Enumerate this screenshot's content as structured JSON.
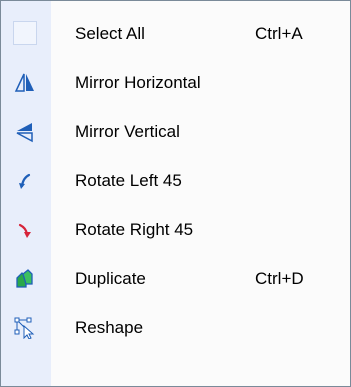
{
  "menu": {
    "items": [
      {
        "label": "Select All",
        "shortcut": "Ctrl+A",
        "icon": "blank-icon"
      },
      {
        "label": "Mirror Horizontal",
        "shortcut": "",
        "icon": "mirror-horizontal-icon"
      },
      {
        "label": "Mirror Vertical",
        "shortcut": "",
        "icon": "mirror-vertical-icon"
      },
      {
        "label": "Rotate Left 45",
        "shortcut": "",
        "icon": "rotate-left-icon"
      },
      {
        "label": "Rotate Right 45",
        "shortcut": "",
        "icon": "rotate-right-icon"
      },
      {
        "label": "Duplicate",
        "shortcut": "Ctrl+D",
        "icon": "duplicate-icon"
      },
      {
        "label": "Reshape",
        "shortcut": "",
        "icon": "reshape-icon"
      }
    ]
  },
  "colors": {
    "gutter": "#e8eefb",
    "background": "#fbfbfb",
    "border": "#7a8a99",
    "icon_blue": "#1f5fb8",
    "icon_green": "#2aa84a",
    "icon_red": "#d6243a"
  }
}
